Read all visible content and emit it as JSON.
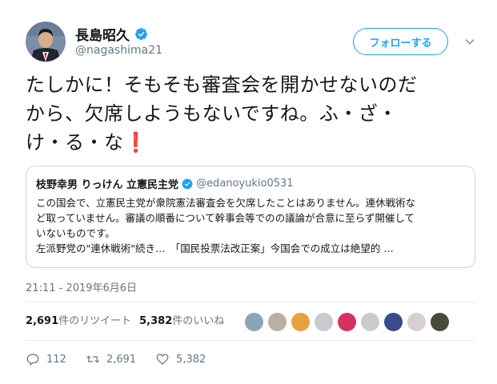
{
  "user": {
    "display_name": "長島昭久",
    "handle": "@nagashima21"
  },
  "follow_button": "フォローする",
  "tweet": {
    "lines": [
      "たしかに！そもそも審査会を開かせないのだ",
      "から、欠席しようもないですね。ふ・ざ・",
      "け・る・な"
    ],
    "emoji": "❗"
  },
  "quote": {
    "name": "枝野幸男 りっけん 立憲民主党",
    "handle": "@edanoyukio0531",
    "lines": [
      "この国会で、立憲民主党が衆院憲法審査会を欠席したことはありません。連休戦術な",
      "ど取っていません。審議の順番について幹事会等でのの議論が合意に至らず開催して",
      "いないものです。",
      "左派野党の\"連休戦術\"続き…　「国民投票法改正案」今国会での成立は絶望的 …"
    ]
  },
  "timestamp": "21:11 - 2019年6月6日",
  "stats": {
    "retweets_count": "2,691",
    "retweets_label": "件のリツイート",
    "likes_count": "5,382",
    "likes_label": "件のいいね"
  },
  "actions": {
    "replies": "112",
    "retweets": "2,691",
    "likes": "5,382"
  },
  "colors": {
    "accent": "#1da1f2",
    "text": "#14171a",
    "muted": "#657786",
    "border": "#ccd6dd",
    "emoji_red": "#dd2e44"
  },
  "liker_colors": [
    "#8aa4b8",
    "#b8b0a0",
    "#e8a040",
    "#c8ccd0",
    "#d83060",
    "#c8ccd0",
    "#3a4a8a",
    "#d8d0d0",
    "#4a4a3a"
  ]
}
